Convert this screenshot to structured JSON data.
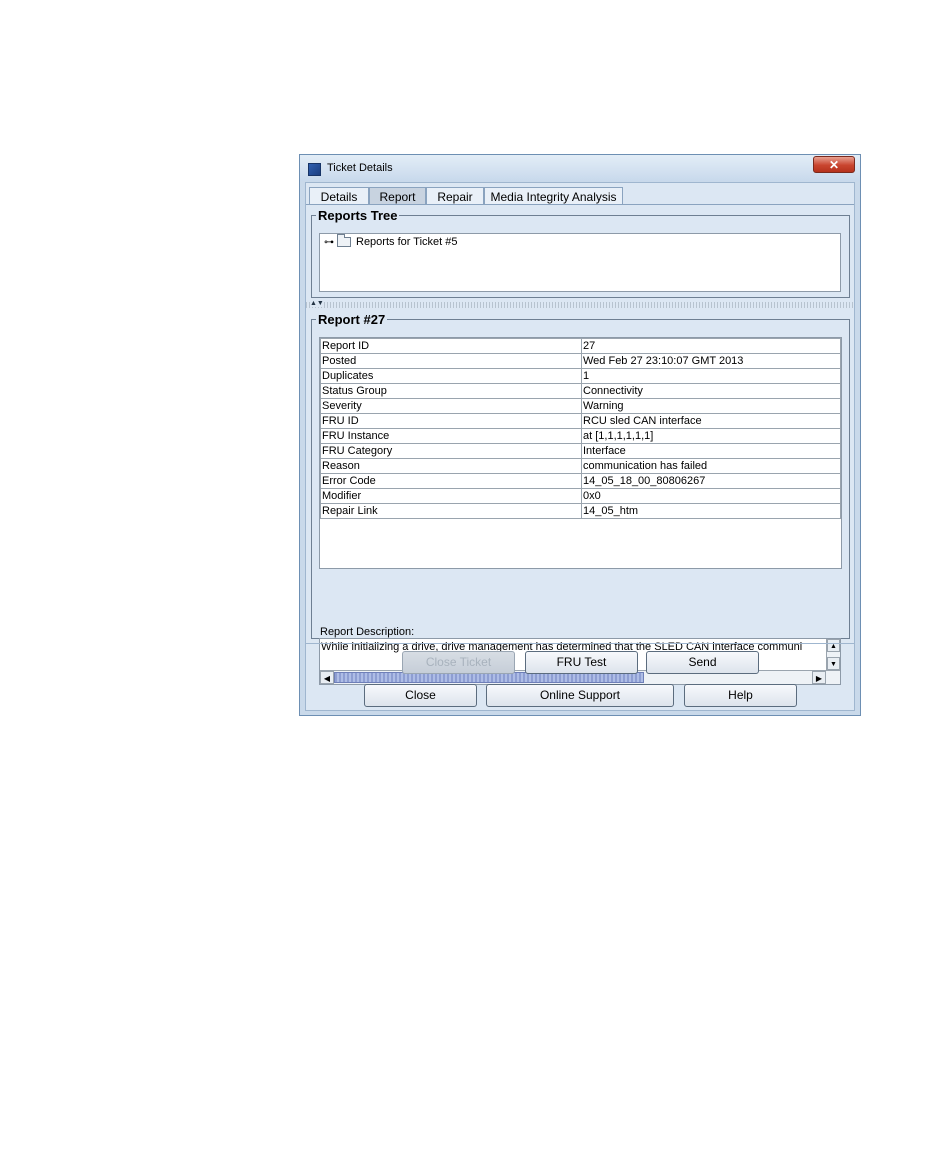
{
  "window": {
    "title": "Ticket Details",
    "close_glyph": "✕"
  },
  "tabs": [
    {
      "label": "Details",
      "active": false
    },
    {
      "label": "Report",
      "active": true
    },
    {
      "label": "Repair",
      "active": false
    },
    {
      "label": "Media Integrity Analysis",
      "active": false
    }
  ],
  "reports_tree": {
    "title": "Reports Tree",
    "items": [
      {
        "label": "Reports for Ticket #5",
        "icon": "folder-icon",
        "expander": "key-icon"
      }
    ]
  },
  "splitter": {
    "arrows": "▲▼"
  },
  "report": {
    "title": "Report #27",
    "rows": [
      {
        "key": "Report ID",
        "value": "27"
      },
      {
        "key": "Posted",
        "value": "Wed Feb 27 23:10:07 GMT 2013"
      },
      {
        "key": "Duplicates",
        "value": "1"
      },
      {
        "key": "Status Group",
        "value": "Connectivity"
      },
      {
        "key": "Severity",
        "value": "Warning"
      },
      {
        "key": "FRU ID",
        "value": "RCU sled CAN interface"
      },
      {
        "key": "FRU Instance",
        "value": "at [1,1,1,1,1,1]"
      },
      {
        "key": "FRU Category",
        "value": "Interface"
      },
      {
        "key": "Reason",
        "value": "communication has failed"
      },
      {
        "key": "Error Code",
        "value": "14_05_18_00_80806267"
      },
      {
        "key": "Modifier",
        "value": "0x0"
      },
      {
        "key": "Repair Link",
        "value": "14_05_htm"
      }
    ],
    "description_label": "Report Description:",
    "description_text": "While initializing a drive, drive management has determined that the SLED CAN interface communi"
  },
  "buttons": {
    "close_ticket": "Close Ticket",
    "fru_test": "FRU Test",
    "send": "Send",
    "close": "Close",
    "online_support": "Online Support",
    "help": "Help"
  },
  "scroll": {
    "up": "▲",
    "down": "▼",
    "left": "◀",
    "right": "▶"
  }
}
